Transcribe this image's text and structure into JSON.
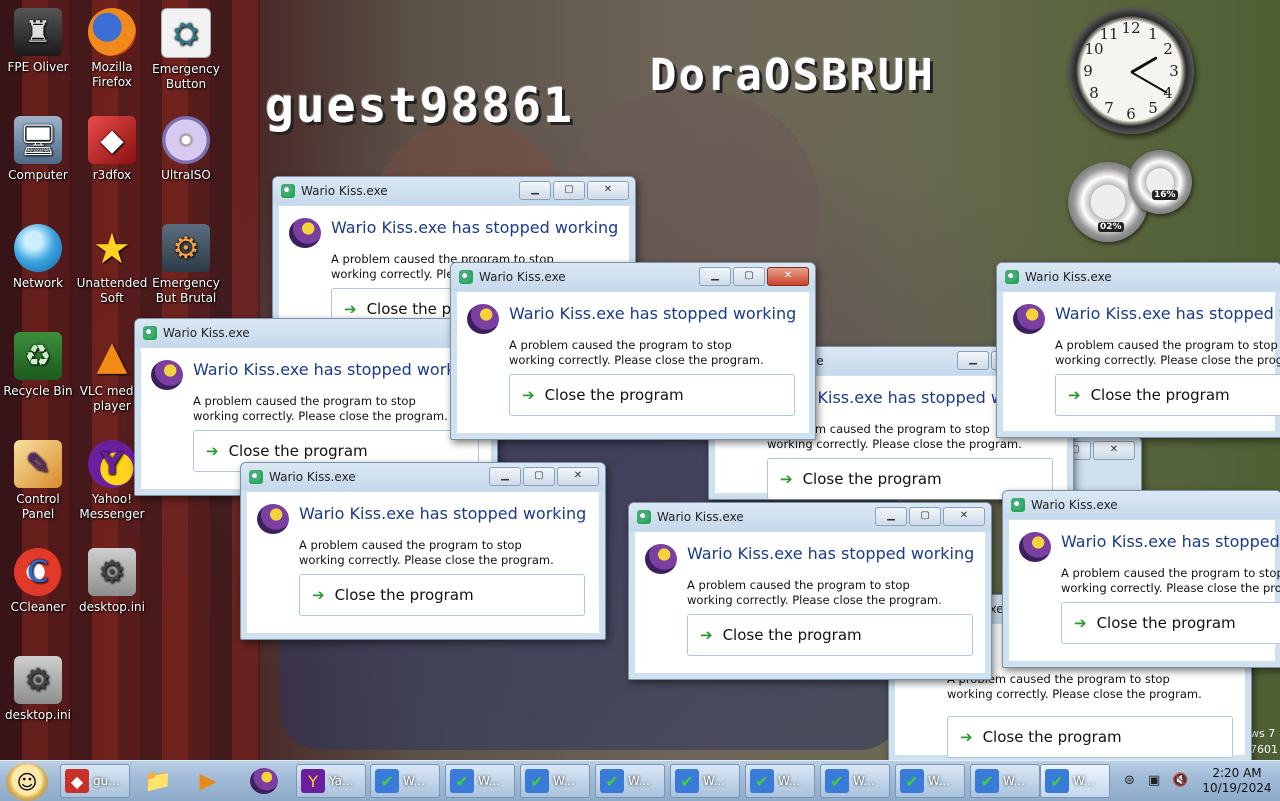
{
  "desktop": {
    "username": "guest98861",
    "os_name": "DoraOSBRUH",
    "corner_text": [
      "ws 7",
      "7601"
    ],
    "icons": [
      {
        "label": "FPE Oliver",
        "icon": "fpe-oliver-icon"
      },
      {
        "label": "Mozilla Firefox",
        "icon": "firefox-icon"
      },
      {
        "label": "Emergency Button",
        "icon": "emergency-button-icon"
      },
      {
        "label": "Computer",
        "icon": "computer-icon"
      },
      {
        "label": "r3dfox",
        "icon": "r3dfox-icon"
      },
      {
        "label": "UltraISO",
        "icon": "ultraiso-icon"
      },
      {
        "label": "Network",
        "icon": "network-icon"
      },
      {
        "label": "Unattended Soft",
        "icon": "star-icon"
      },
      {
        "label": "Emergency But Brutal",
        "icon": "emergency-brutal-icon"
      },
      {
        "label": "Recycle Bin",
        "icon": "recycle-bin-icon"
      },
      {
        "label": "VLC media player",
        "icon": "vlc-icon"
      },
      {
        "label": "Control Panel",
        "icon": "control-panel-icon"
      },
      {
        "label": "Yahoo! Messenger",
        "icon": "yahoo-messenger-icon"
      },
      {
        "label": "CCleaner",
        "icon": "ccleaner-icon"
      },
      {
        "label": "desktop.ini",
        "icon": "ini-file-icon"
      },
      {
        "label": "desktop.ini",
        "icon": "ini-file-icon"
      }
    ],
    "gadgets": {
      "clock_numbers": [
        "12",
        "1",
        "2",
        "3",
        "4",
        "5",
        "6",
        "7",
        "8",
        "9",
        "10",
        "11"
      ],
      "cpu": "02%",
      "memory": "16%"
    }
  },
  "dialog": {
    "title": "Wario Kiss.exe",
    "heading": "Wario Kiss.exe has stopped working",
    "message": "A problem caused the program to stop working correctly. Please close the program.",
    "close_label": "Close the program",
    "controls": {
      "minimize": "▁",
      "maximize": "▢",
      "close": "✕"
    }
  },
  "taskbar": {
    "buttons": [
      {
        "label": "gu...",
        "icon": "r3dfox-icon"
      },
      {
        "label": "",
        "icon": "explorer-folder-icon"
      },
      {
        "label": "",
        "icon": "media-player-icon"
      },
      {
        "label": "",
        "icon": "wario-kiss-icon"
      },
      {
        "label": "Ya...",
        "icon": "yahoo-messenger-icon"
      },
      {
        "label": "W...",
        "icon": "warning-check-icon"
      },
      {
        "label": "W...",
        "icon": "warning-check-icon"
      },
      {
        "label": "W...",
        "icon": "warning-check-icon"
      },
      {
        "label": "W...",
        "icon": "warning-check-icon"
      },
      {
        "label": "W...",
        "icon": "warning-check-icon"
      },
      {
        "label": "W...",
        "icon": "warning-check-icon"
      },
      {
        "label": "W...",
        "icon": "warning-check-icon"
      },
      {
        "label": "W...",
        "icon": "warning-check-icon"
      },
      {
        "label": "W...",
        "icon": "warning-check-icon"
      },
      {
        "label": "W...",
        "icon": "warning-check-icon"
      }
    ],
    "clock_time": "2:20 AM",
    "clock_date": "10/19/2024"
  }
}
